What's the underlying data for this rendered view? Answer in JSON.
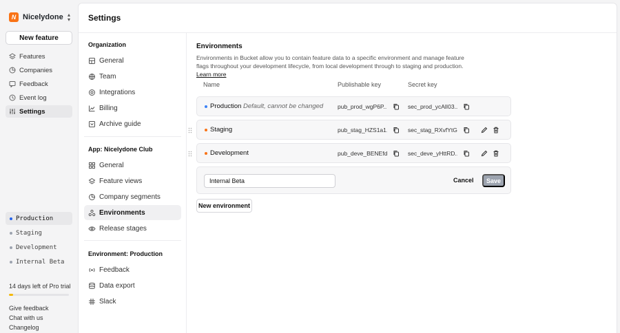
{
  "org": {
    "name": "Nicelydone C...",
    "logo_letter": "N",
    "brand_color": "#f97316"
  },
  "app_sidebar": {
    "new_feature_label": "New feature",
    "nav": [
      {
        "label": "Features",
        "icon": "features-icon"
      },
      {
        "label": "Companies",
        "icon": "companies-icon"
      },
      {
        "label": "Feedback",
        "icon": "feedback-icon"
      },
      {
        "label": "Event log",
        "icon": "event-log-icon"
      },
      {
        "label": "Settings",
        "icon": "settings-icon",
        "active": true
      }
    ],
    "environments": [
      {
        "label": "Production",
        "active": true,
        "dot_color": "#2563eb"
      },
      {
        "label": "Staging",
        "dot_color": "#9ca3af"
      },
      {
        "label": "Development",
        "dot_color": "#9ca3af"
      },
      {
        "label": "Internal Beta",
        "dot_color": "#9ca3af"
      }
    ],
    "trial_text": "14 days left of Pro trial",
    "trial_progress": 0.07,
    "footer_links": [
      "Give feedback",
      "Chat with us",
      "Changelog"
    ]
  },
  "page": {
    "title": "Settings"
  },
  "settings_nav": {
    "org_section": "Organization",
    "org_items": [
      "General",
      "Team",
      "Integrations",
      "Billing",
      "Archive guide"
    ],
    "app_section": "App: Nicelydone Club",
    "app_items": [
      "General",
      "Feature views",
      "Company segments",
      "Environments",
      "Release stages"
    ],
    "env_section": "Environment: Production",
    "env_items": [
      "Feedback",
      "Data export",
      "Slack"
    ]
  },
  "environments": {
    "title": "Environments",
    "description": "Environments in Bucket allow you to contain feature data to a specific environment and manage feature flags throughout your development lifecycle, from local development through to staging and production.",
    "learn_more": "Learn more",
    "columns": {
      "name": "Name",
      "publishable_key": "Publishable key",
      "secret_key": "Secret key"
    },
    "rows": [
      {
        "name": "Production",
        "note": "Default, cannot be changed",
        "pub_key": "pub_prod_wgP6P...",
        "secret_key": "sec_prod_ycAlI03...",
        "dot_color": "#3b82f6"
      },
      {
        "name": "Staging",
        "note": "",
        "pub_key": "pub_stag_HZS1a1...",
        "secret_key": "sec_stag_RXvfYtG...",
        "dot_color": "#f97316"
      },
      {
        "name": "Development",
        "note": "",
        "pub_key": "pub_deve_BENEfd...",
        "secret_key": "sec_deve_yHttRD...",
        "dot_color": "#f97316"
      }
    ],
    "new_env_input_value": "Internal Beta",
    "cancel_label": "Cancel",
    "save_label": "Save",
    "new_env_button": "New environment"
  }
}
